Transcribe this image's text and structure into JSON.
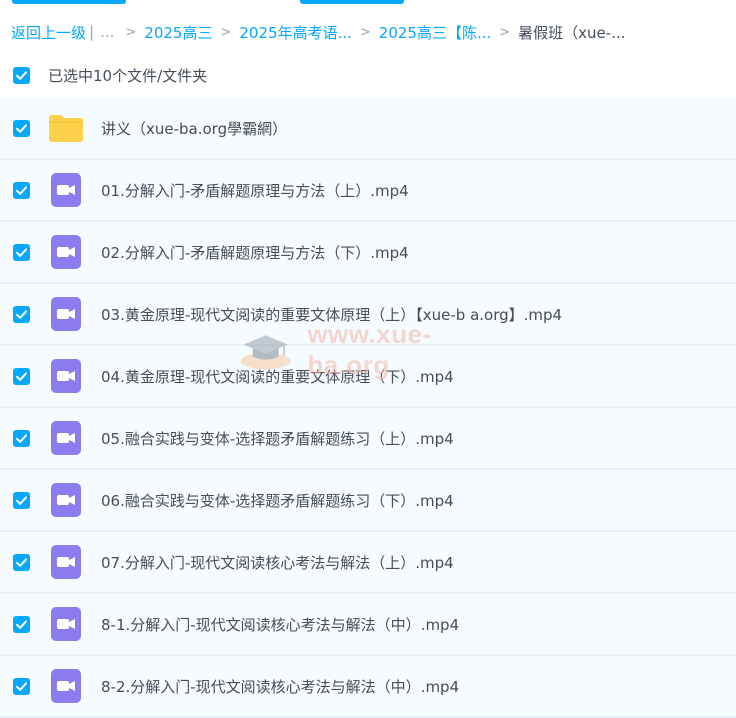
{
  "breadcrumb": {
    "back": "返回上一级",
    "divider": "|",
    "ellipsis": "...",
    "crumbs": [
      "2025高三",
      "2025年高考语...",
      "2025高三【陈..."
    ],
    "current": "暑假班（xue-..."
  },
  "selection": {
    "label": "已选中10个文件/文件夹"
  },
  "files": [
    {
      "type": "folder",
      "name": "讲义（xue-ba.org學霸網）"
    },
    {
      "type": "video",
      "name": "01.分解入门-矛盾解题原理与方法（上）.mp4"
    },
    {
      "type": "video",
      "name": "02.分解入门-矛盾解题原理与方法（下）.mp4"
    },
    {
      "type": "video",
      "name": "03.黄金原理-现代文阅读的重要文体原理（上）【xue-b a.org】.mp4"
    },
    {
      "type": "video",
      "name": "04.黄金原理-现代文阅读的重要文体原理（下）.mp4"
    },
    {
      "type": "video",
      "name": "05.融合实践与变体-选择题矛盾解题练习（上）.mp4"
    },
    {
      "type": "video",
      "name": "06.融合实践与变体-选择题矛盾解题练习（下）.mp4"
    },
    {
      "type": "video",
      "name": "07.分解入门-现代文阅读核心考法与解法（上）.mp4"
    },
    {
      "type": "video",
      "name": "8-1.分解入门-现代文阅读核心考法与解法（中）.mp4"
    },
    {
      "type": "video",
      "name": "8-2.分解入门-现代文阅读核心考法与解法（中）.mp4"
    }
  ],
  "watermark": {
    "text": "www.xue-ba.org"
  },
  "colors": {
    "accent": "#06a7ff",
    "folder": "#ffd04b",
    "video": "#8d7cf0",
    "row_bg": "#f5fbff"
  }
}
